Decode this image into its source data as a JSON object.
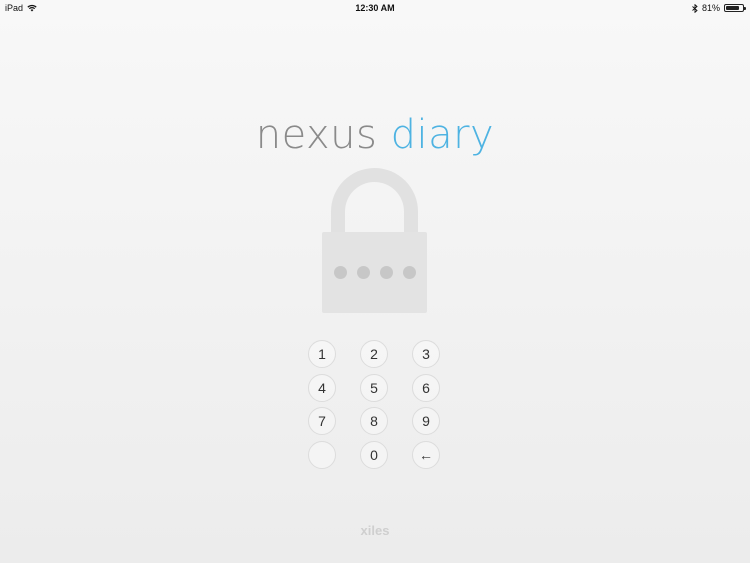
{
  "status_bar": {
    "device": "iPad",
    "time": "12:30 AM",
    "battery_percent": "81%",
    "battery_level": 0.81,
    "icons": [
      "wifi-icon",
      "bluetooth-icon",
      "battery-icon"
    ]
  },
  "app": {
    "title_word_1": "nexus",
    "title_word_2": "diary",
    "title_color_1": "#8a8a8a",
    "title_color_2": "#4eb3e2",
    "footer": "xiles"
  },
  "lock": {
    "icon": "lock-icon",
    "pin_length": 4,
    "pin_entered": 0
  },
  "keypad": {
    "keys": [
      "1",
      "2",
      "3",
      "4",
      "5",
      "6",
      "7",
      "8",
      "9",
      "",
      "0",
      "←"
    ]
  }
}
